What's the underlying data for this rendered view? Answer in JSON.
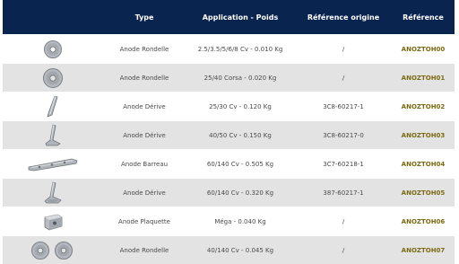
{
  "headers": {
    "image": "",
    "type": "Type",
    "application": "Application - Poids",
    "reference": "Référence origine",
    "ref": "Référence"
  },
  "rows": [
    {
      "icon": "round-washer-anode-icon",
      "type": "Anode Rondelle",
      "application": "2.5/3.5/5/6/8 Cv - 0.010 Kg",
      "reference": "/",
      "ref": "ANOZTOH00"
    },
    {
      "icon": "round-washer-anode-icon",
      "type": "Anode Rondelle",
      "application": "25/40 Corsa - 0.020 Kg",
      "reference": "/",
      "ref": "ANOZTOH01"
    },
    {
      "icon": "fin-anode-icon",
      "type": "Anode Dérive",
      "application": "25/30 Cv - 0.120 Kg",
      "reference": "3C8-60217-1",
      "ref": "ANOZTOH02"
    },
    {
      "icon": "fin-anode-icon",
      "type": "Anode Dérive",
      "application": "40/50 Cv - 0.150 Kg",
      "reference": "3C8-60217-0",
      "ref": "ANOZTOH03"
    },
    {
      "icon": "bar-anode-icon",
      "type": "Anode Barreau",
      "application": "60/140 Cv - 0.505 Kg",
      "reference": "3C7-60218-1",
      "ref": "ANOZTOH04"
    },
    {
      "icon": "fin-anode-icon",
      "type": "Anode Dérive",
      "application": "60/140 Cv - 0.320 Kg",
      "reference": "387-60217-1",
      "ref": "ANOZTOH05"
    },
    {
      "icon": "plate-anode-icon",
      "type": "Anode Plaquette",
      "application": "Méga - 0.040 Kg",
      "reference": "/",
      "ref": "ANOZTOH06"
    },
    {
      "icon": "double-washer-anode-icon",
      "type": "Anode Rondelle",
      "application": "40/140 Cv - 0.045 Kg",
      "reference": "/",
      "ref": "ANOZTOH07"
    }
  ]
}
